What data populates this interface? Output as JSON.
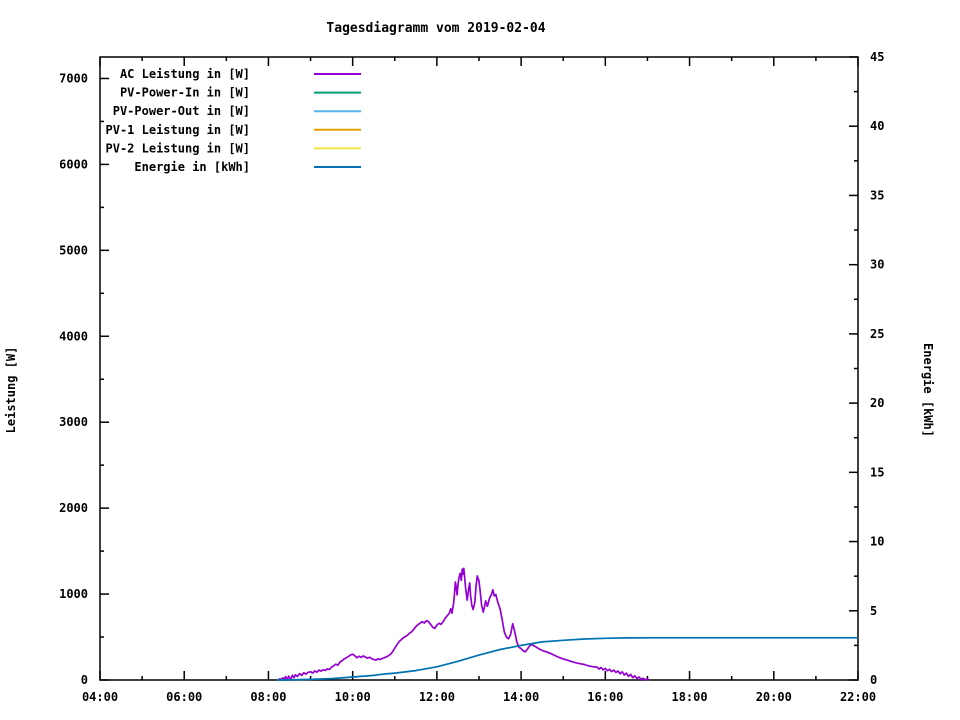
{
  "title": "Tagesdiagramm vom 2019-02-04",
  "colors": {
    "foreground": "#000000",
    "background": "#ffffff",
    "ac": "#9400d3",
    "pv_power_in": "#009e73",
    "pv_power_out": "#56b4e9",
    "pv1": "#e69f00",
    "pv2": "#f0e442",
    "energie": "#0072b2"
  },
  "axes": {
    "left": {
      "label": "Leistung [W]"
    },
    "right": {
      "label": "Energie [kWh]"
    }
  },
  "chart_data": {
    "type": "line",
    "title": "Tagesdiagramm vom 2019-02-04",
    "x_axis": {
      "unit": "time",
      "range_hours": [
        4,
        22
      ],
      "major_tick_hours": 2,
      "minor_tick_hours": 1,
      "tick_labels": [
        "04:00",
        "06:00",
        "08:00",
        "10:00",
        "12:00",
        "14:00",
        "16:00",
        "18:00",
        "20:00",
        "22:00"
      ],
      "grid": false
    },
    "y_left": {
      "label": "Leistung [W]",
      "range": [
        0,
        7250
      ],
      "major_step": 1000,
      "minor_step": 500,
      "tick_labels": [
        "0",
        "1000",
        "2000",
        "3000",
        "4000",
        "5000",
        "6000",
        "7000"
      ]
    },
    "y_right": {
      "label": "Energie [kWh]",
      "range": [
        0,
        45
      ],
      "major_step": 5,
      "minor_step": 2.5,
      "tick_labels": [
        "0",
        "5",
        "10",
        "15",
        "20",
        "25",
        "30",
        "35",
        "40",
        "45"
      ]
    },
    "legend_position": "top-left-inside",
    "series": [
      {
        "name": "AC Leistung in [W]",
        "color": "#9400d3",
        "axis": "left",
        "points": [
          [
            8.22,
            0
          ],
          [
            8.28,
            15
          ],
          [
            8.31,
            0
          ],
          [
            8.34,
            25
          ],
          [
            8.37,
            8
          ],
          [
            8.41,
            40
          ],
          [
            8.44,
            0
          ],
          [
            8.48,
            45
          ],
          [
            8.51,
            20
          ],
          [
            8.53,
            0
          ],
          [
            8.57,
            55
          ],
          [
            8.61,
            28
          ],
          [
            8.64,
            60
          ],
          [
            8.69,
            42
          ],
          [
            8.74,
            75
          ],
          [
            8.79,
            55
          ],
          [
            8.84,
            85
          ],
          [
            8.89,
            68
          ],
          [
            8.94,
            90
          ],
          [
            9.0,
            95
          ],
          [
            9.05,
            82
          ],
          [
            9.1,
            105
          ],
          [
            9.15,
            92
          ],
          [
            9.2,
            115
          ],
          [
            9.25,
            103
          ],
          [
            9.3,
            120
          ],
          [
            9.35,
            110
          ],
          [
            9.4,
            130
          ],
          [
            9.45,
            122
          ],
          [
            9.5,
            150
          ],
          [
            9.55,
            165
          ],
          [
            9.6,
            185
          ],
          [
            9.65,
            172
          ],
          [
            9.7,
            210
          ],
          [
            9.75,
            225
          ],
          [
            9.8,
            245
          ],
          [
            9.85,
            260
          ],
          [
            9.9,
            275
          ],
          [
            9.95,
            292
          ],
          [
            10.0,
            300
          ],
          [
            10.05,
            283
          ],
          [
            10.1,
            260
          ],
          [
            10.15,
            277
          ],
          [
            10.2,
            263
          ],
          [
            10.25,
            280
          ],
          [
            10.3,
            268
          ],
          [
            10.35,
            252
          ],
          [
            10.4,
            265
          ],
          [
            10.45,
            248
          ],
          [
            10.5,
            238
          ],
          [
            10.55,
            232
          ],
          [
            10.6,
            245
          ],
          [
            10.65,
            238
          ],
          [
            10.7,
            250
          ],
          [
            10.75,
            258
          ],
          [
            10.8,
            270
          ],
          [
            10.85,
            283
          ],
          [
            10.9,
            300
          ],
          [
            10.95,
            330
          ],
          [
            11.0,
            370
          ],
          [
            11.05,
            410
          ],
          [
            11.1,
            445
          ],
          [
            11.15,
            468
          ],
          [
            11.2,
            490
          ],
          [
            11.25,
            505
          ],
          [
            11.3,
            520
          ],
          [
            11.35,
            545
          ],
          [
            11.4,
            560
          ],
          [
            11.45,
            590
          ],
          [
            11.5,
            620
          ],
          [
            11.55,
            645
          ],
          [
            11.6,
            660
          ],
          [
            11.65,
            680
          ],
          [
            11.7,
            663
          ],
          [
            11.75,
            690
          ],
          [
            11.8,
            678
          ],
          [
            11.85,
            648
          ],
          [
            11.9,
            615
          ],
          [
            11.95,
            600
          ],
          [
            12.0,
            640
          ],
          [
            12.05,
            660
          ],
          [
            12.1,
            648
          ],
          [
            12.15,
            680
          ],
          [
            12.2,
            720
          ],
          [
            12.25,
            750
          ],
          [
            12.3,
            780
          ],
          [
            12.33,
            830
          ],
          [
            12.36,
            778
          ],
          [
            12.4,
            900
          ],
          [
            12.42,
            1020
          ],
          [
            12.44,
            1140
          ],
          [
            12.46,
            1075
          ],
          [
            12.48,
            990
          ],
          [
            12.5,
            1100
          ],
          [
            12.52,
            1180
          ],
          [
            12.55,
            1240
          ],
          [
            12.58,
            1160
          ],
          [
            12.6,
            1290
          ],
          [
            12.62,
            1230
          ],
          [
            12.64,
            1300
          ],
          [
            12.66,
            1190
          ],
          [
            12.68,
            1080
          ],
          [
            12.7,
            1000
          ],
          [
            12.72,
            930
          ],
          [
            12.75,
            1050
          ],
          [
            12.78,
            1130
          ],
          [
            12.8,
            980
          ],
          [
            12.83,
            870
          ],
          [
            12.86,
            820
          ],
          [
            12.9,
            900
          ],
          [
            12.93,
            1100
          ],
          [
            12.96,
            1210
          ],
          [
            13.0,
            1150
          ],
          [
            13.03,
            1020
          ],
          [
            13.06,
            880
          ],
          [
            13.1,
            790
          ],
          [
            13.13,
            850
          ],
          [
            13.16,
            920
          ],
          [
            13.2,
            858
          ],
          [
            13.25,
            950
          ],
          [
            13.3,
            1000
          ],
          [
            13.33,
            1050
          ],
          [
            13.36,
            980
          ],
          [
            13.4,
            995
          ],
          [
            13.45,
            900
          ],
          [
            13.5,
            830
          ],
          [
            13.55,
            700
          ],
          [
            13.6,
            560
          ],
          [
            13.65,
            500
          ],
          [
            13.7,
            480
          ],
          [
            13.75,
            530
          ],
          [
            13.8,
            655
          ],
          [
            13.85,
            558
          ],
          [
            13.9,
            440
          ],
          [
            13.95,
            380
          ],
          [
            14.0,
            365
          ],
          [
            14.05,
            340
          ],
          [
            14.1,
            328
          ],
          [
            14.15,
            360
          ],
          [
            14.2,
            395
          ],
          [
            14.25,
            415
          ],
          [
            14.3,
            400
          ],
          [
            14.35,
            385
          ],
          [
            14.4,
            370
          ],
          [
            14.45,
            355
          ],
          [
            14.5,
            345
          ],
          [
            14.55,
            335
          ],
          [
            14.6,
            328
          ],
          [
            14.7,
            310
          ],
          [
            14.8,
            285
          ],
          [
            14.9,
            263
          ],
          [
            15.0,
            245
          ],
          [
            15.1,
            230
          ],
          [
            15.2,
            214
          ],
          [
            15.3,
            200
          ],
          [
            15.4,
            190
          ],
          [
            15.5,
            180
          ],
          [
            15.6,
            165
          ],
          [
            15.7,
            155
          ],
          [
            15.8,
            150
          ],
          [
            15.85,
            128
          ],
          [
            15.9,
            145
          ],
          [
            15.95,
            118
          ],
          [
            16.0,
            135
          ],
          [
            16.05,
            108
          ],
          [
            16.1,
            125
          ],
          [
            16.15,
            98
          ],
          [
            16.2,
            115
          ],
          [
            16.25,
            88
          ],
          [
            16.3,
            105
          ],
          [
            16.35,
            72
          ],
          [
            16.4,
            95
          ],
          [
            16.45,
            58
          ],
          [
            16.5,
            80
          ],
          [
            16.55,
            42
          ],
          [
            16.6,
            65
          ],
          [
            16.65,
            28
          ],
          [
            16.7,
            50
          ],
          [
            16.75,
            18
          ],
          [
            16.8,
            35
          ],
          [
            16.85,
            8
          ],
          [
            16.9,
            20
          ],
          [
            16.95,
            4
          ],
          [
            17.0,
            10
          ],
          [
            17.05,
            0
          ]
        ]
      },
      {
        "name": "PV-Power-In in [W]",
        "color": "#009e73",
        "axis": "left",
        "points": []
      },
      {
        "name": "PV-Power-Out in [W]",
        "color": "#56b4e9",
        "axis": "left",
        "points": []
      },
      {
        "name": "PV-1 Leistung in [W]",
        "color": "#e69f00",
        "axis": "left",
        "points": []
      },
      {
        "name": "PV-2 Leistung in [W]",
        "color": "#f0e442",
        "axis": "left",
        "points": []
      },
      {
        "name": "Energie in [kWh]",
        "color": "#0072b2",
        "axis": "right",
        "points": [
          [
            8.2,
            0.0
          ],
          [
            8.5,
            0.01
          ],
          [
            9.0,
            0.04
          ],
          [
            9.5,
            0.1
          ],
          [
            10.0,
            0.22
          ],
          [
            10.5,
            0.33
          ],
          [
            10.75,
            0.43
          ],
          [
            11.0,
            0.5
          ],
          [
            11.5,
            0.68
          ],
          [
            12.0,
            0.95
          ],
          [
            12.5,
            1.35
          ],
          [
            13.0,
            1.8
          ],
          [
            13.5,
            2.2
          ],
          [
            13.95,
            2.47
          ],
          [
            14.0,
            2.5
          ],
          [
            14.5,
            2.75
          ],
          [
            15.0,
            2.87
          ],
          [
            15.5,
            2.96
          ],
          [
            16.0,
            3.01
          ],
          [
            16.5,
            3.04
          ],
          [
            17.0,
            3.05
          ],
          [
            18.0,
            3.05
          ],
          [
            20.0,
            3.05
          ],
          [
            22.0,
            3.05
          ]
        ]
      }
    ]
  }
}
